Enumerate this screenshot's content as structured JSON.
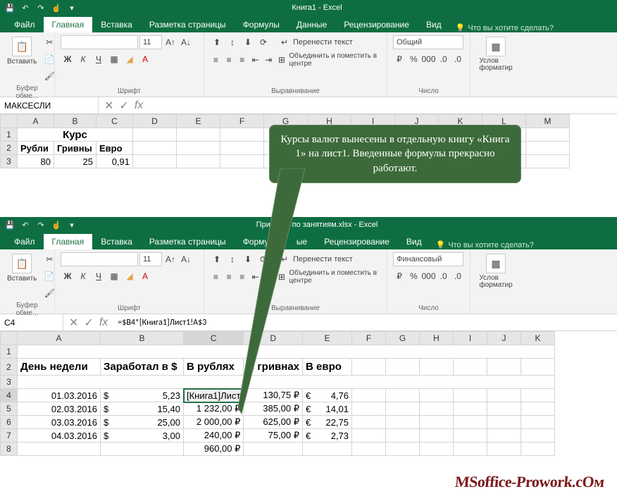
{
  "win1": {
    "title": "Книга1 - Excel",
    "tabs": {
      "file": "Файл",
      "home": "Главная",
      "insert": "Вставка",
      "page_layout": "Разметка страницы",
      "formulas": "Формулы",
      "data": "Данные",
      "review": "Рецензирование",
      "view": "Вид"
    },
    "tell_me": "Что вы хотите сделать?",
    "ribbon": {
      "clipboard": {
        "paste": "Вставить",
        "label": "Буфер обме..."
      },
      "font": {
        "size": "11",
        "label": "Шрифт",
        "bold": "Ж",
        "italic": "К",
        "underline": "Ч"
      },
      "alignment": {
        "wrap": "Перенести текст",
        "merge": "Объединить и поместить в центре",
        "label": "Выравнивание"
      },
      "number": {
        "format": "Общий",
        "label": "Число"
      },
      "styles": {
        "cond": "Услов\nформатир"
      }
    },
    "namebox": "МАКСЕСЛИ",
    "formula": "",
    "grid": {
      "cols": [
        "A",
        "B",
        "C",
        "D",
        "E",
        "F",
        "G",
        "H",
        "I",
        "J",
        "K",
        "L",
        "M"
      ],
      "rows": [
        {
          "n": "1",
          "cells": [
            {
              "v": "Курс",
              "span": 3,
              "b": true,
              "c": true
            }
          ]
        },
        {
          "n": "2",
          "cells": [
            {
              "v": "Рубли",
              "b": true
            },
            {
              "v": "Гривны",
              "b": true
            },
            {
              "v": "Евро",
              "b": true
            }
          ]
        },
        {
          "n": "3",
          "cells": [
            {
              "v": "80",
              "r": true
            },
            {
              "v": "25",
              "r": true
            },
            {
              "v": "0,91",
              "r": true
            }
          ]
        }
      ]
    }
  },
  "win2": {
    "title": "Примеры по занятиям.xlsx - Excel",
    "tabs": {
      "file": "Файл",
      "home": "Главная",
      "insert": "Вставка",
      "page_layout": "Разметка страницы",
      "formulas": "Формулы",
      "data": "ые",
      "review": "Рецензирование",
      "view": "Вид"
    },
    "tell_me": "Что вы хотите сделать?",
    "ribbon": {
      "clipboard": {
        "paste": "Вставить",
        "label": "Буфер обме..."
      },
      "font": {
        "size": "11",
        "label": "Шрифт",
        "bold": "Ж",
        "italic": "К",
        "underline": "Ч"
      },
      "alignment": {
        "wrap": "Перенести текст",
        "merge": "Объединить и поместить в центре",
        "label": "Выравнивание"
      },
      "number": {
        "format": "Финансовый",
        "label": "Число"
      },
      "styles": {
        "cond": "Услов\nформатир"
      }
    },
    "namebox": "C4",
    "formula": "=$B4*[Книга1]Лист1!A$3",
    "grid": {
      "cols": [
        "A",
        "B",
        "C",
        "D",
        "E",
        "F",
        "G",
        "H",
        "I",
        "J",
        "K"
      ],
      "header_row": "2",
      "headers": [
        "День недели",
        "Заработал в $",
        "В рублях",
        "В гривнах",
        "В евро"
      ],
      "sel": {
        "row": "4",
        "col": "C",
        "val": "[Книга1]Лист"
      },
      "rows": [
        {
          "n": "4",
          "a": "01.03.2016",
          "b_sym": "$",
          "b": "5,23",
          "c": "[Книга1]Лист",
          "d": "130,75 ₽",
          "e_sym": "€",
          "e": "4,76"
        },
        {
          "n": "5",
          "a": "02.03.2016",
          "b_sym": "$",
          "b": "15,40",
          "c": "1 232,00 ₽",
          "d": "385,00 ₽",
          "e_sym": "€",
          "e": "14,01"
        },
        {
          "n": "6",
          "a": "03.03.2016",
          "b_sym": "$",
          "b": "25,00",
          "c": "2 000,00 ₽",
          "d": "625,00 ₽",
          "e_sym": "€",
          "e": "22,75"
        },
        {
          "n": "7",
          "a": "04.03.2016",
          "b_sym": "$",
          "b": "3,00",
          "c": "240,00 ₽",
          "d": "75,00 ₽",
          "e_sym": "€",
          "e": "2,73"
        },
        {
          "n": "8",
          "a": "",
          "b_sym": "",
          "b": "",
          "c": "960,00 ₽",
          "d": "",
          "e_sym": "",
          "e": ""
        }
      ]
    }
  },
  "callout": "Курсы валют вынесены в отдельную книгу «Книга 1» на лист1. Введенные формулы прекрасно работают.",
  "watermark": "MSoffice-Prowork.cOм"
}
